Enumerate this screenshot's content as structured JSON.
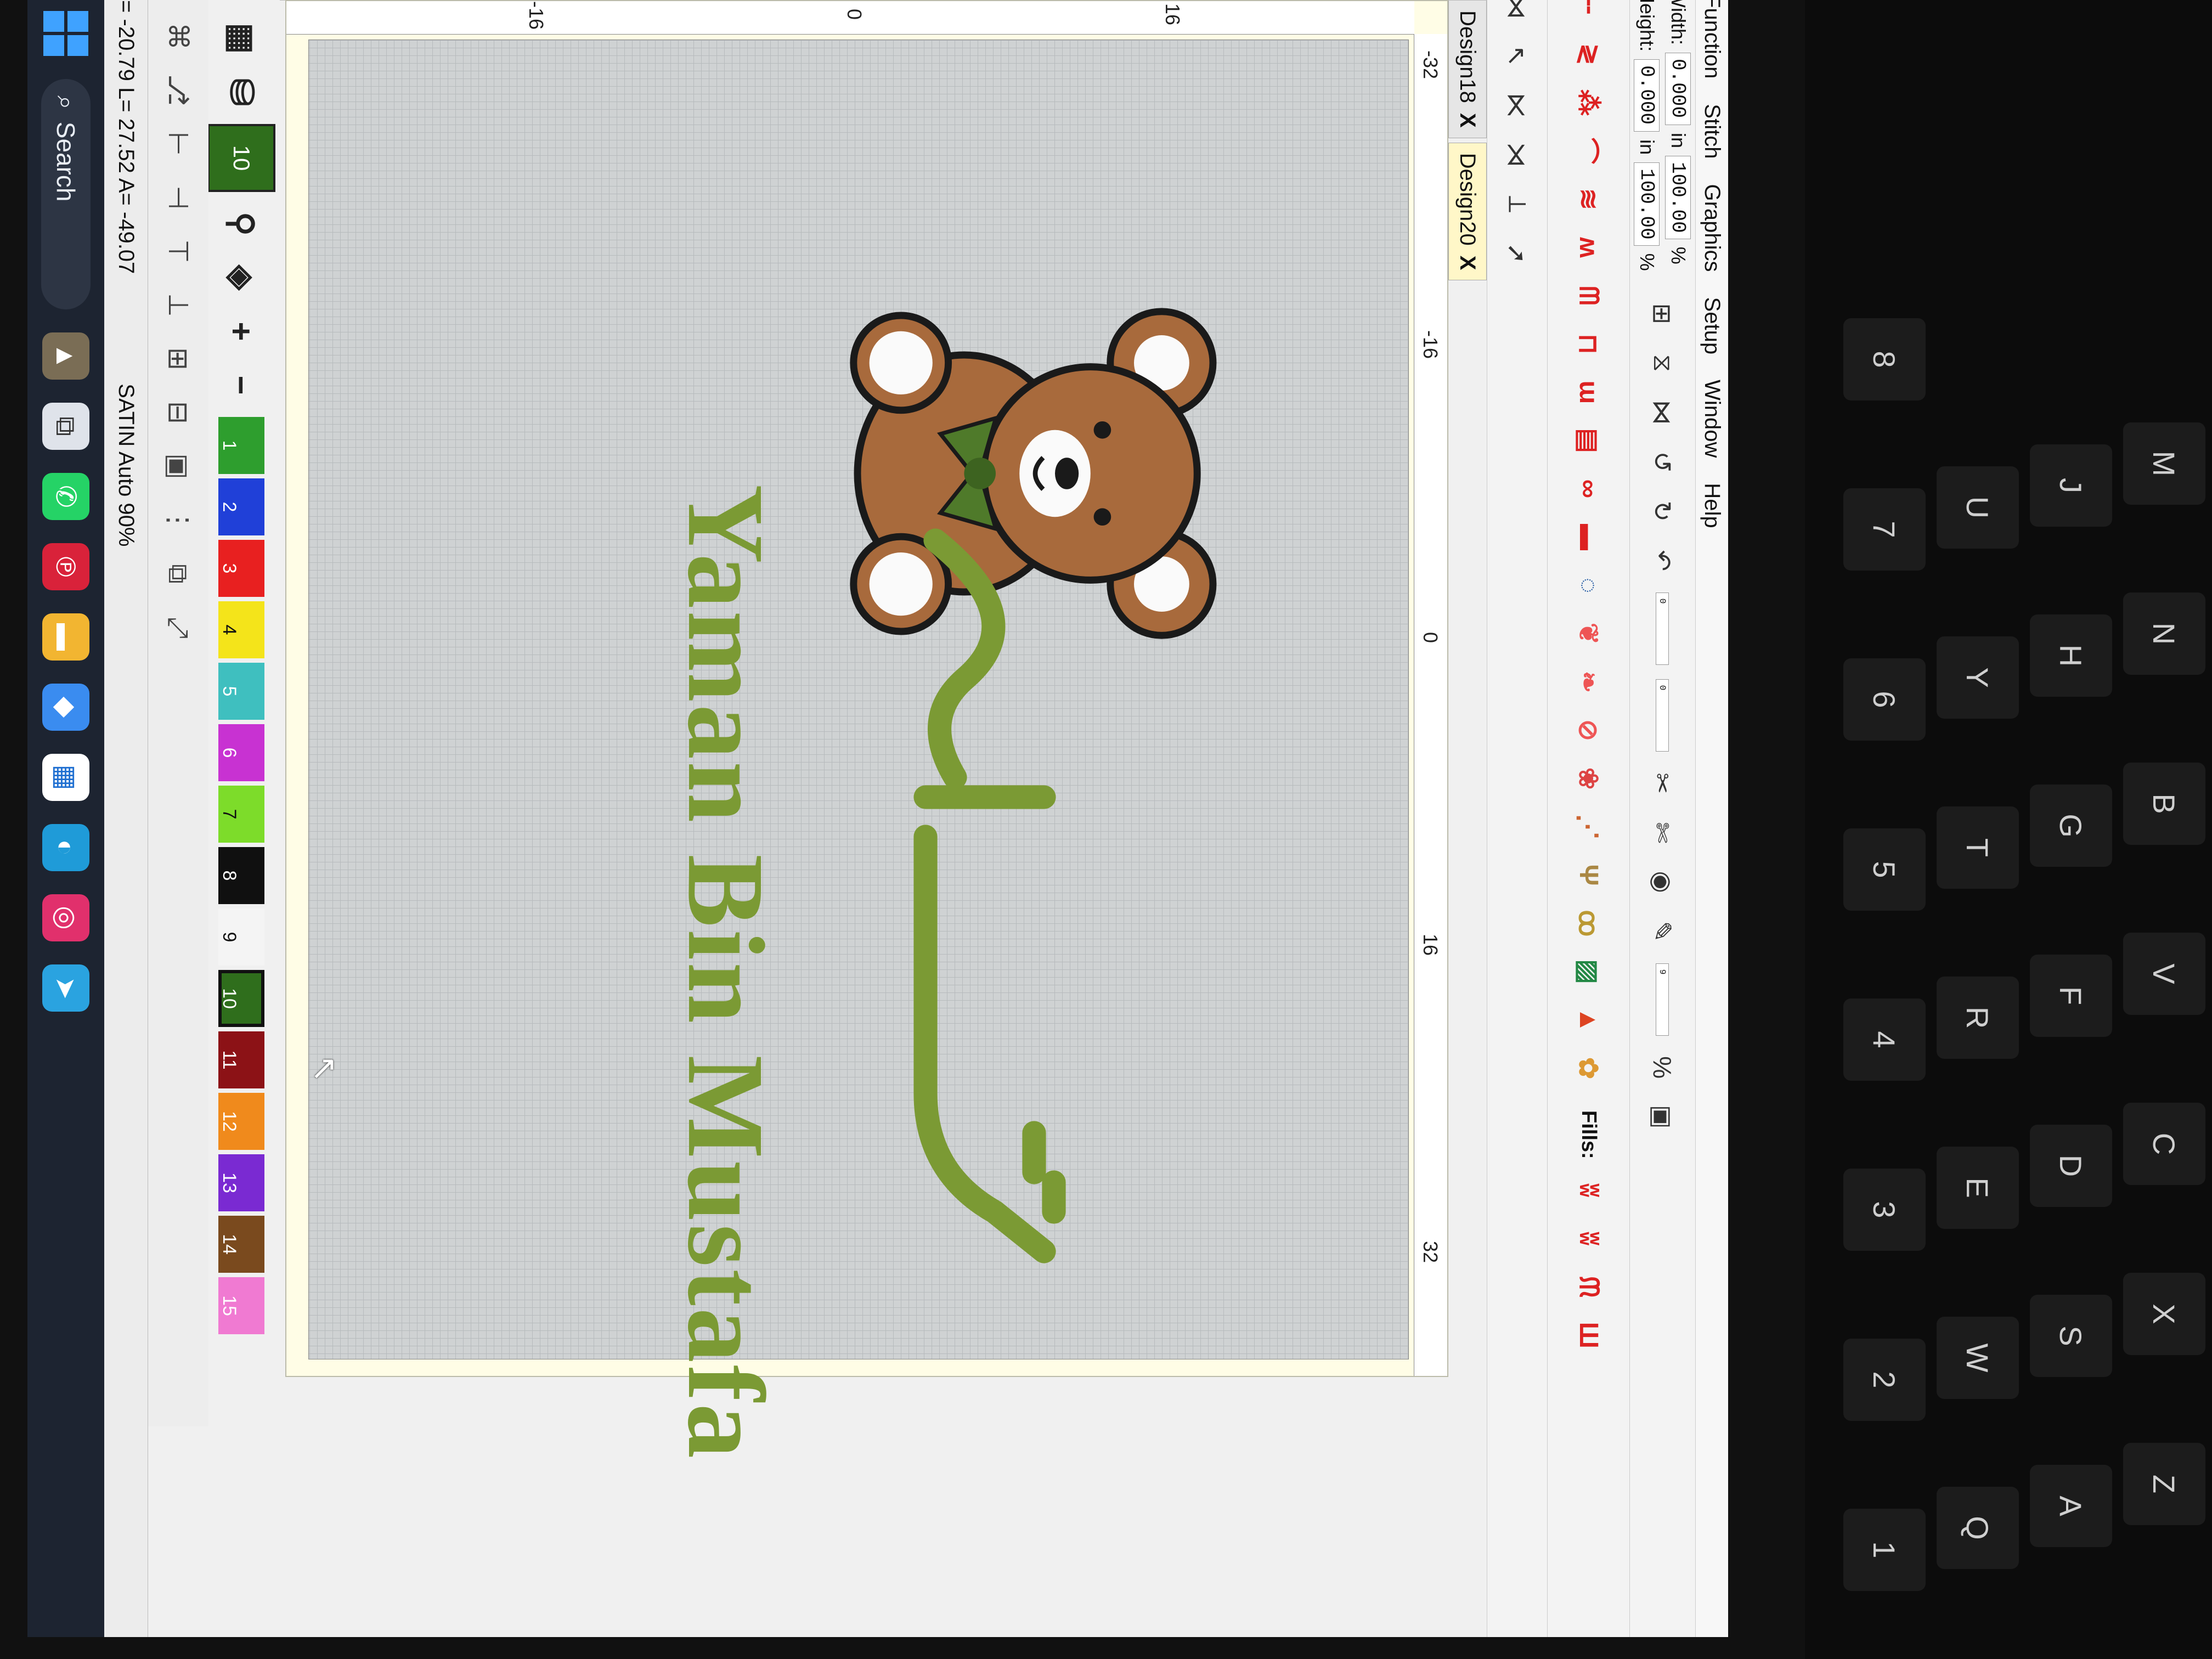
{
  "menu": [
    "Function",
    "Stitch",
    "Graphics",
    "Setup",
    "Window",
    "Help"
  ],
  "dimensions": {
    "width_label": "Width:",
    "width_value": "0.000",
    "width_unit": "in",
    "width_pct": "100.00",
    "height_label": "Height:",
    "height_value": "0.000",
    "height_unit": "in",
    "height_pct": "100.00",
    "pct_unit": "%",
    "field_zero": "0",
    "zoom_value": "9"
  },
  "fills_label": "Fills:",
  "tabs": [
    {
      "label": "Design18",
      "close": "X"
    },
    {
      "label": "Design20",
      "close": "X"
    }
  ],
  "ruler": {
    "top": [
      "-32",
      "-16",
      "0",
      "16",
      "32"
    ],
    "left": [
      "16",
      "0",
      "-16"
    ]
  },
  "design": {
    "name_text": "Yaman Bin Mustafa",
    "arabic_color": "#7b9a34",
    "bear_color": "#a86a3c",
    "ribbon_color": "#4f7a2a"
  },
  "palette": {
    "current": "10",
    "current_color": "#2f6e1c",
    "colors": [
      {
        "n": "1",
        "hex": "#2e9e2e"
      },
      {
        "n": "2",
        "hex": "#2040d8"
      },
      {
        "n": "3",
        "hex": "#e82020"
      },
      {
        "n": "4",
        "hex": "#f4e41a"
      },
      {
        "n": "5",
        "hex": "#3fbfbf"
      },
      {
        "n": "6",
        "hex": "#c832d2"
      },
      {
        "n": "7",
        "hex": "#7ddc2a"
      },
      {
        "n": "8",
        "hex": "#101010"
      },
      {
        "n": "9",
        "hex": "#f4f4f4"
      },
      {
        "n": "10",
        "hex": "#2f6e1c"
      },
      {
        "n": "11",
        "hex": "#8c1216"
      },
      {
        "n": "12",
        "hex": "#f08a1c"
      },
      {
        "n": "13",
        "hex": "#7a2ad2"
      },
      {
        "n": "14",
        "hex": "#7a4a1e"
      },
      {
        "n": "15",
        "hex": "#f07ad2"
      }
    ]
  },
  "status": {
    "coords": "= -20.79 L= 27.52 A= -49.07",
    "stitch_mode": "SATIN Auto 90%"
  },
  "taskbar": {
    "search_label": "Search"
  },
  "keyboard": [
    "Q",
    "W",
    "E",
    "R",
    "T",
    "Y",
    "U",
    "A",
    "S",
    "D",
    "F",
    "G",
    "H",
    "J",
    "Z",
    "X",
    "C",
    "V",
    "B",
    "N",
    "M",
    "1",
    "2",
    "3",
    "4",
    "5",
    "6",
    "7",
    "8"
  ]
}
